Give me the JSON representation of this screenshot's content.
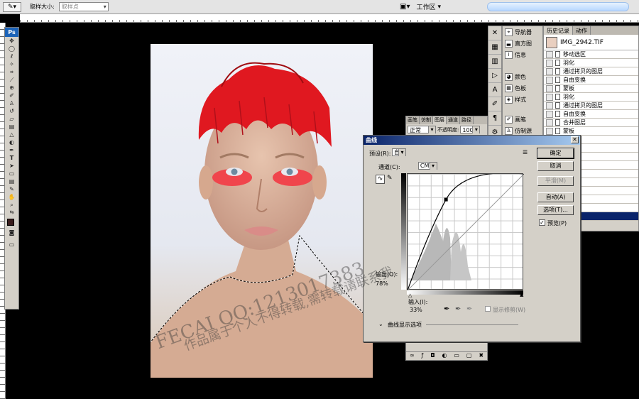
{
  "options_bar": {
    "sample_size_label": "取样大小:",
    "sample_size_value": "取样点",
    "workspace_label": "工作区"
  },
  "toolbox": {
    "logo": "Ps"
  },
  "dock_panel": {
    "items": [
      {
        "label": "导航器",
        "icon": "navigator-icon"
      },
      {
        "label": "直方图",
        "icon": "histogram-icon"
      },
      {
        "label": "信息",
        "icon": "info-icon"
      },
      {
        "label": "颜色",
        "icon": "color-icon"
      },
      {
        "label": "色板",
        "icon": "swatches-icon"
      },
      {
        "label": "样式",
        "icon": "styles-icon"
      },
      {
        "label": "画笔",
        "icon": "brush-icon"
      },
      {
        "label": "仿制源",
        "icon": "clone-source-icon"
      }
    ]
  },
  "history_panel": {
    "tabs": [
      "历史记录",
      "动作"
    ],
    "snapshot": "IMG_2942.TIF",
    "rows": [
      "移动选区",
      "羽化",
      "通过拷贝的图层",
      "自由变换",
      "蒙板",
      "羽化",
      "通过拷贝的图层",
      "自由变换",
      "合并图层",
      "蒙板",
      "区",
      "",
      "",
      "的图层",
      "换",
      "合并",
      "",
      "",
      "1 图层",
      "选区"
    ]
  },
  "layers_panel": {
    "tabs": [
      "画笔",
      "仿制",
      "图层",
      "通道",
      "路径"
    ],
    "blend_mode": "正常",
    "opacity_label": "不透明度:",
    "opacity_value": "100%"
  },
  "curves_dialog": {
    "title": "曲线",
    "preset_label": "预设(R):",
    "preset_value": "自定",
    "channel_label": "通道(C):",
    "channel_value": "CMYK",
    "output_label": "输出(O):",
    "output_value": "78%",
    "input_label": "输入(I):",
    "input_value": "33%",
    "show_clipping": "显示修剪(W)",
    "curve_display_options": "曲线显示选项",
    "buttons": {
      "ok": "确定",
      "cancel": "取消",
      "smooth": "平滑(M)",
      "auto": "自动(A)",
      "options": "选项(T)..."
    },
    "preview_label": "预览(P)",
    "preview_checked": true,
    "control_point": {
      "input": 33,
      "output": 78
    }
  },
  "watermark": {
    "line1": "FECAI QQ:1213017383",
    "line2": "作品属于个人不得转载,需转载请联系我"
  },
  "colors": {
    "titlebar": "#0a246a",
    "panel_bg": "#d4d0c8",
    "feather_red": "#e01820"
  }
}
